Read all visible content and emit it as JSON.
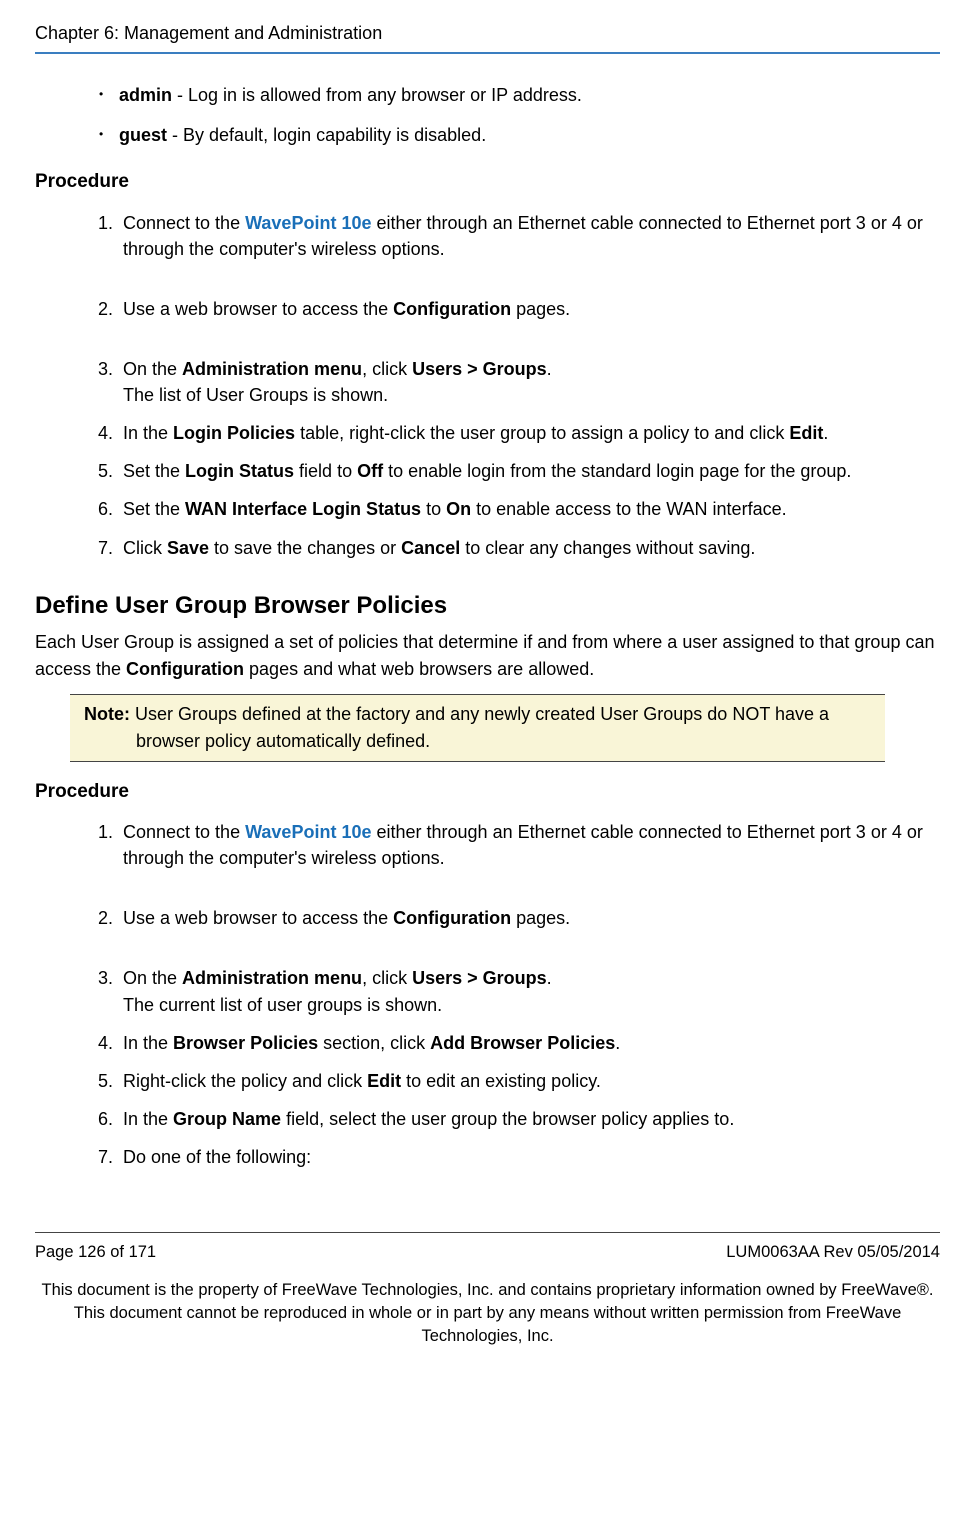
{
  "header": {
    "chapter": "Chapter 6: Management and Administration"
  },
  "intro_bullets": {
    "admin_label": "admin",
    "admin_text": " - Log in is allowed from any browser or IP address.",
    "guest_label": "guest",
    "guest_text": " - By default, login capability is disabled."
  },
  "procedure1": {
    "heading": "Procedure",
    "items": {
      "s1a": "Connect to the ",
      "s1link": "WavePoint 10e",
      "s1b": " either through an Ethernet cable connected to Ethernet port 3 or 4 or through the computer's wireless options.",
      "s2a": "Use a web browser to access the ",
      "s2bold": "Configuration",
      "s2b": " pages.",
      "s3a": "On the ",
      "s3bold1": "Administration menu",
      "s3b": ", click ",
      "s3bold2": "Users > Groups",
      "s3c": ".",
      "s3sub": "The list of User Groups is shown.",
      "s4a": "In the ",
      "s4bold1": "Login Policies",
      "s4b": " table, right-click the user group to assign a policy to and click ",
      "s4bold2": "Edit",
      "s4c": ".",
      "s5a": "Set the ",
      "s5bold1": "Login Status",
      "s5b": " field to ",
      "s5bold2": "Off",
      "s5c": " to enable login from the standard login page for the group.",
      "s6a": "Set the ",
      "s6bold1": "WAN Interface Login Status",
      "s6b": " to ",
      "s6bold2": "On",
      "s6c": " to enable access to the WAN interface.",
      "s7a": "Click ",
      "s7bold1": "Save",
      "s7b": " to save the changes or ",
      "s7bold2": "Cancel",
      "s7c": " to clear any changes without saving."
    }
  },
  "section2": {
    "title": "Define User Group Browser Policies",
    "intro_a": "Each User Group is assigned a set of policies that determine if and from where a user assigned to that group can access the ",
    "intro_bold": "Configuration",
    "intro_b": " pages and what web browsers are allowed.",
    "note_label": "Note:",
    "note_text": " User Groups defined at the factory and any newly created User Groups do NOT have a browser policy automatically defined."
  },
  "procedure2": {
    "heading": "Procedure",
    "items": {
      "s1a": "Connect to the ",
      "s1link": "WavePoint 10e",
      "s1b": " either through an Ethernet cable connected to Ethernet port 3 or 4 or through the computer's wireless options.",
      "s2a": "Use a web browser to access the ",
      "s2bold": "Configuration",
      "s2b": " pages.",
      "s3a": "On the ",
      "s3bold1": "Administration menu",
      "s3b": ", click ",
      "s3bold2": "Users > Groups",
      "s3c": ".",
      "s3sub": "The current list of user groups is shown.",
      "s4a": "In the ",
      "s4bold1": "Browser Policies",
      "s4b": " section, click ",
      "s4bold2": "Add Browser Policies",
      "s4c": ".",
      "s5a": "Right-click the policy and click ",
      "s5bold1": "Edit",
      "s5b": " to edit an existing policy.",
      "s6a": "In the ",
      "s6bold1": "Group Name",
      "s6b": " field, select the user group the browser policy applies to.",
      "s7a": "Do one of the following:"
    }
  },
  "footer": {
    "page": "Page 126 of 171",
    "rev": "LUM0063AA Rev 05/05/2014",
    "legal": "This document is the property of FreeWave Technologies, Inc. and contains proprietary information owned by FreeWave®. This document cannot be reproduced in whole or in part by any means without written permission from FreeWave Technologies, Inc."
  }
}
